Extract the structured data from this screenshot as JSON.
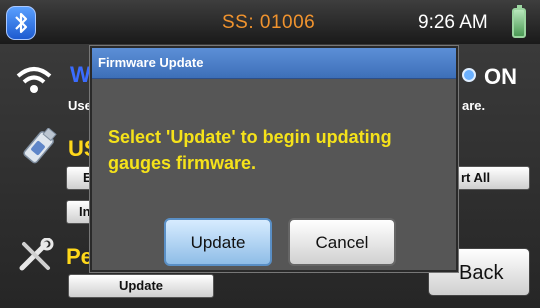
{
  "status_bar": {
    "ss_label": "SS: 01006",
    "time": "9:26 AM"
  },
  "settings": {
    "wifi_heading": "W",
    "wifi_desc_left": "Use",
    "wifi_desc_right": "are.",
    "wifi_state": "ON",
    "usb_heading": "US",
    "usb_btn_1": "E",
    "usb_btn_2": "In",
    "usb_btn_all": "rt All",
    "pe_heading": "Pe",
    "update_label": "Update",
    "back_label": "Back"
  },
  "dialog": {
    "title": "Firmware Update",
    "message": "Select 'Update' to begin updating gauges firmware.",
    "update_label": "Update",
    "cancel_label": "Cancel"
  },
  "colors": {
    "ss_text": "#f0932e",
    "heading_yellow": "#ffd81a",
    "title_bar": "#4a7dc6",
    "message_text": "#f5e21a"
  },
  "icons": [
    "bluetooth-icon",
    "battery-icon",
    "wifi-icon",
    "usb-drive-icon",
    "tools-icon"
  ]
}
